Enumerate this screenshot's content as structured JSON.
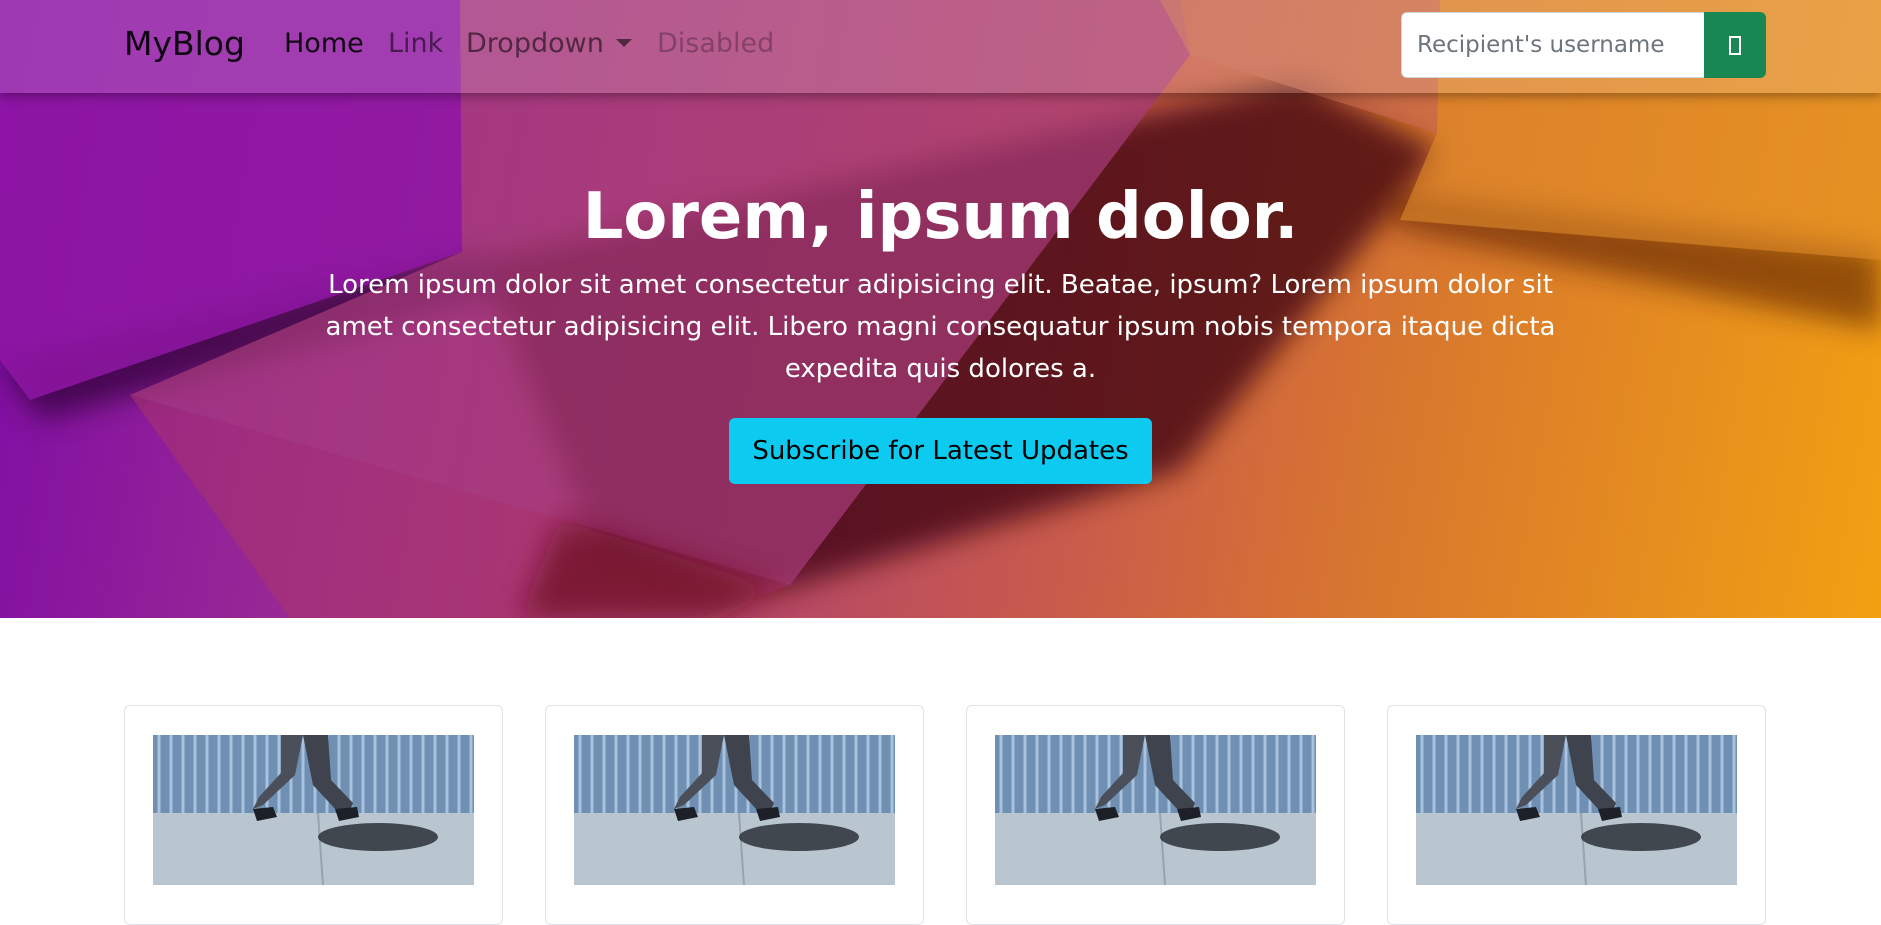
{
  "navbar": {
    "brand": "MyBlog",
    "links": [
      {
        "label": "Home",
        "state": "active"
      },
      {
        "label": "Link",
        "state": "default"
      },
      {
        "label": "Dropdown",
        "state": "dropdown"
      },
      {
        "label": "Disabled",
        "state": "disabled"
      }
    ],
    "search": {
      "placeholder": "Recipient's username",
      "button_icon": "box-icon"
    }
  },
  "hero": {
    "title": "Lorem, ipsum dolor.",
    "text": "Lorem ipsum dolor sit amet consectetur adipisicing elit. Beatae, ipsum? Lorem ipsum dolor sit amet consectetur adipisicing elit. Libero magni consequatur ipsum nobis tempora itaque dicta expedita quis dolores a.",
    "button_label": "Subscribe for Latest Updates"
  },
  "cards": [
    {
      "image": "walking-person-photo"
    },
    {
      "image": "walking-person-photo"
    },
    {
      "image": "walking-person-photo"
    },
    {
      "image": "walking-person-photo"
    }
  ],
  "colors": {
    "accent_info": "#0dcaf0",
    "search_button": "#198754",
    "gradient_start": "#7d0aa6",
    "gradient_end": "#f2a112"
  }
}
